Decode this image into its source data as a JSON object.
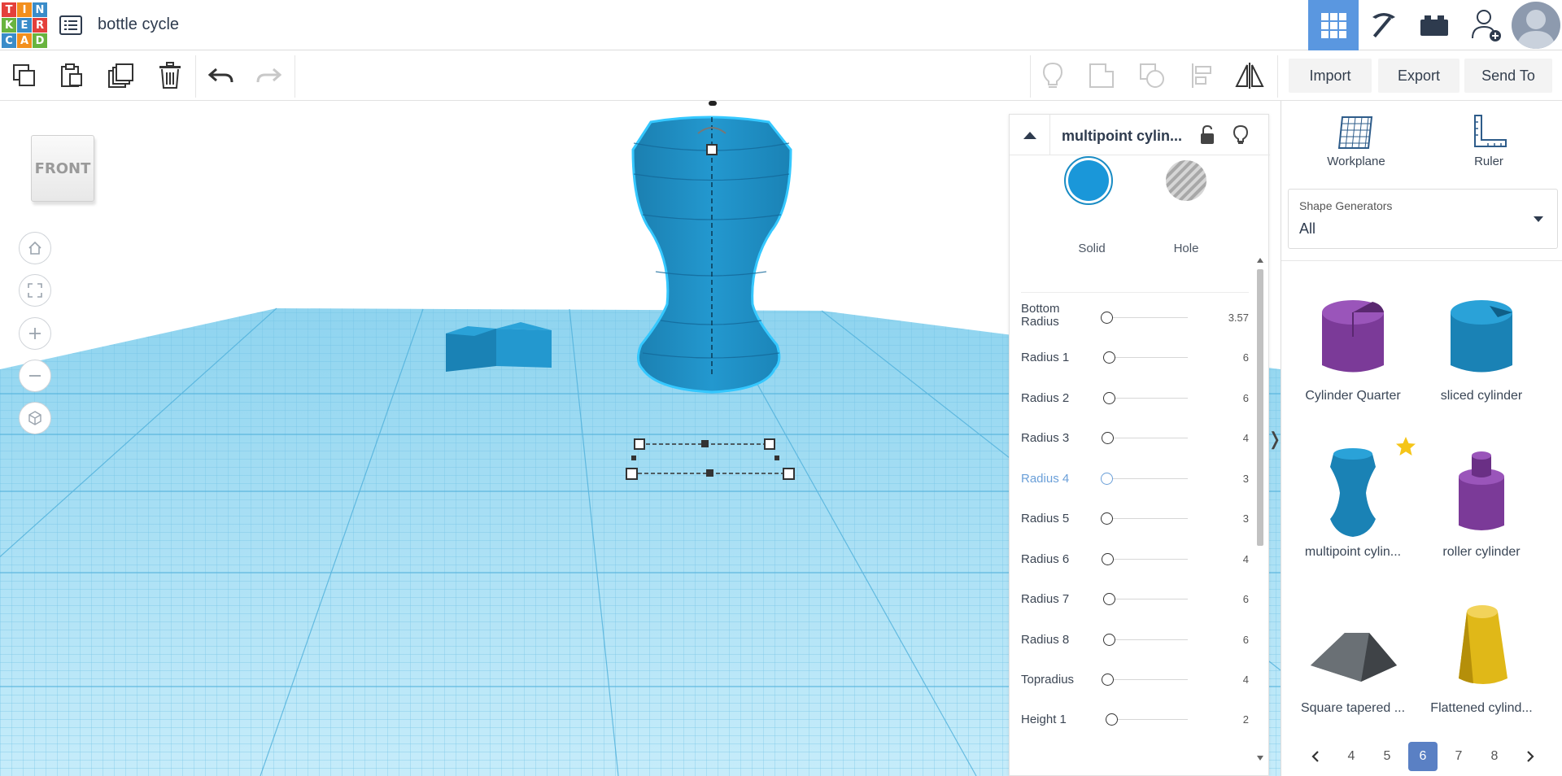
{
  "logo": {
    "letters": [
      "T",
      "I",
      "N",
      "K",
      "E",
      "R",
      "C",
      "A",
      "D"
    ]
  },
  "header": {
    "title": "bottle cycle"
  },
  "views": [
    "3d-design",
    "build",
    "bricks"
  ],
  "toolbar": {
    "import_label": "Import",
    "export_label": "Export",
    "sendto_label": "Send To"
  },
  "viewport": {
    "view_cube_label": "FRONT"
  },
  "inspector": {
    "title": "multipoint cylin...",
    "solid_label": "Solid",
    "hole_label": "Hole",
    "params": [
      {
        "label": "Bottom Radius",
        "value": "3.57",
        "knob_fraction": 0.0
      },
      {
        "label": "Radius 1",
        "value": "6",
        "knob_fraction": 0.03
      },
      {
        "label": "Radius 2",
        "value": "6",
        "knob_fraction": 0.03
      },
      {
        "label": "Radius 3",
        "value": "4",
        "knob_fraction": 0.01
      },
      {
        "label": "Radius 4",
        "value": "3",
        "knob_fraction": 0.0,
        "active": true
      },
      {
        "label": "Radius 5",
        "value": "3",
        "knob_fraction": 0.0
      },
      {
        "label": "Radius 6",
        "value": "4",
        "knob_fraction": 0.01
      },
      {
        "label": "Radius 7",
        "value": "6",
        "knob_fraction": 0.03
      },
      {
        "label": "Radius 8",
        "value": "6",
        "knob_fraction": 0.03
      },
      {
        "label": "Topradius",
        "value": "4",
        "knob_fraction": 0.01
      },
      {
        "label": "Height 1",
        "value": "2",
        "knob_fraction": 0.06
      }
    ]
  },
  "panel": {
    "workplane_label": "Workplane",
    "ruler_label": "Ruler",
    "dropdown_label": "Shape Generators",
    "dropdown_value": "All",
    "shapes": [
      {
        "name": "Cylinder Quarter",
        "color": "#7b3a98"
      },
      {
        "name": "sliced cylinder",
        "color": "#1a8cc4"
      },
      {
        "name": "multipoint cylin...",
        "color": "#1a8cc4",
        "favorite": true
      },
      {
        "name": "roller cylinder",
        "color": "#7b3a98"
      },
      {
        "name": "Square tapered ...",
        "color": "#555a5e"
      },
      {
        "name": "Flattened cylind...",
        "color": "#e0b818"
      }
    ],
    "pages": [
      "4",
      "5",
      "6",
      "7",
      "8"
    ],
    "current_page": "6"
  },
  "colors": {
    "accent": "#5a97e0",
    "shape_blue": "#1a8cc4",
    "workplane": "#8fd4ef"
  }
}
